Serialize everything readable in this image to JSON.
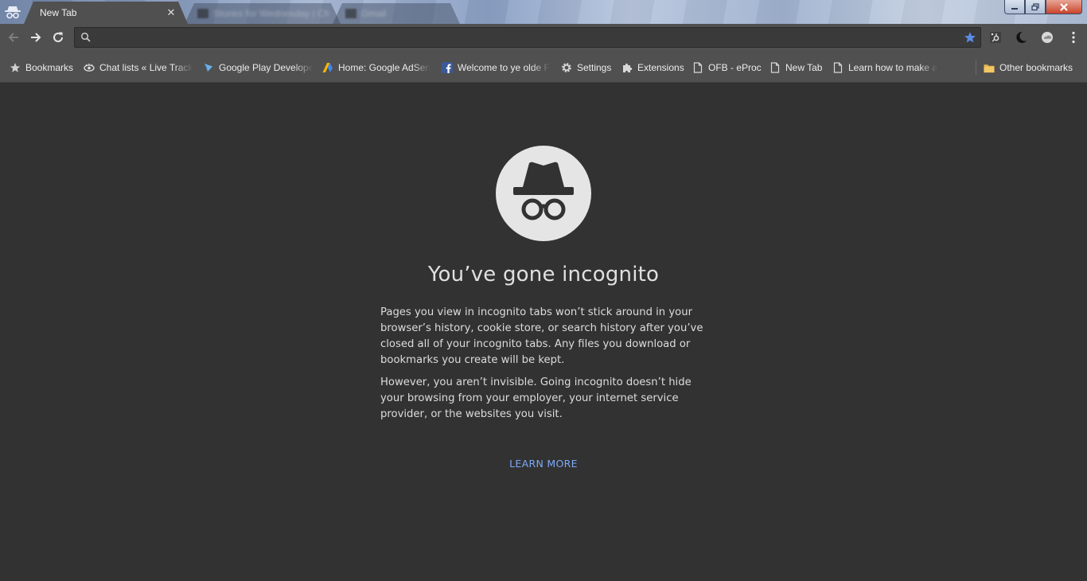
{
  "tabs": {
    "active": {
      "title": "New Tab",
      "close_icon": "close-icon"
    },
    "background": [
      {
        "title": "Stories for Wednesday | Ch"
      },
      {
        "title": "Gmail"
      }
    ]
  },
  "toolbar": {
    "back_icon": "arrow-left-icon",
    "forward_icon": "arrow-right-icon",
    "reload_icon": "reload-icon",
    "omnibox": {
      "value": "",
      "placeholder": "",
      "search_icon": "search-icon",
      "bookmark_star_icon": "star-icon"
    },
    "extensions": [
      "hubspot-icon",
      "moon-icon",
      "cloud-icon"
    ],
    "menu_icon": "kebab-menu-icon"
  },
  "bookmarks": {
    "items": [
      {
        "label": "Bookmarks",
        "icon": "star-icon"
      },
      {
        "label": "Chat lists « Live Track",
        "icon": "eye-icon"
      },
      {
        "label": "Google Play Develope",
        "icon": "play-console-icon"
      },
      {
        "label": "Home: Google AdSen",
        "icon": "adsense-icon"
      },
      {
        "label": "Welcome to ye olde F",
        "icon": "facebook-icon"
      },
      {
        "label": "Settings",
        "icon": "gear-icon"
      },
      {
        "label": "Extensions",
        "icon": "puzzle-icon"
      },
      {
        "label": "OFB - eProc",
        "icon": "page-icon"
      },
      {
        "label": "New Tab",
        "icon": "page-icon"
      },
      {
        "label": "Learn how to make a",
        "icon": "page-icon"
      }
    ],
    "other": {
      "label": "Other bookmarks",
      "icon": "folder-icon"
    }
  },
  "ntp": {
    "icon": "incognito-icon",
    "title": "You’ve gone incognito",
    "paragraph1": "Pages you view in incognito tabs won’t stick around in your browser’s history, cookie store, or search history after you’ve closed all of your incognito tabs. Any files you download or bookmarks you create will be kept.",
    "paragraph2": "However, you aren’t invisible. Going incognito doesn’t hide your browsing from your employer, your internet service provider, or the websites you visit.",
    "learn_more": "LEARN MORE"
  },
  "colors": {
    "background": "#323232",
    "toolbar": "#505050",
    "link": "#7baaf7",
    "star": "#5b8de6"
  }
}
